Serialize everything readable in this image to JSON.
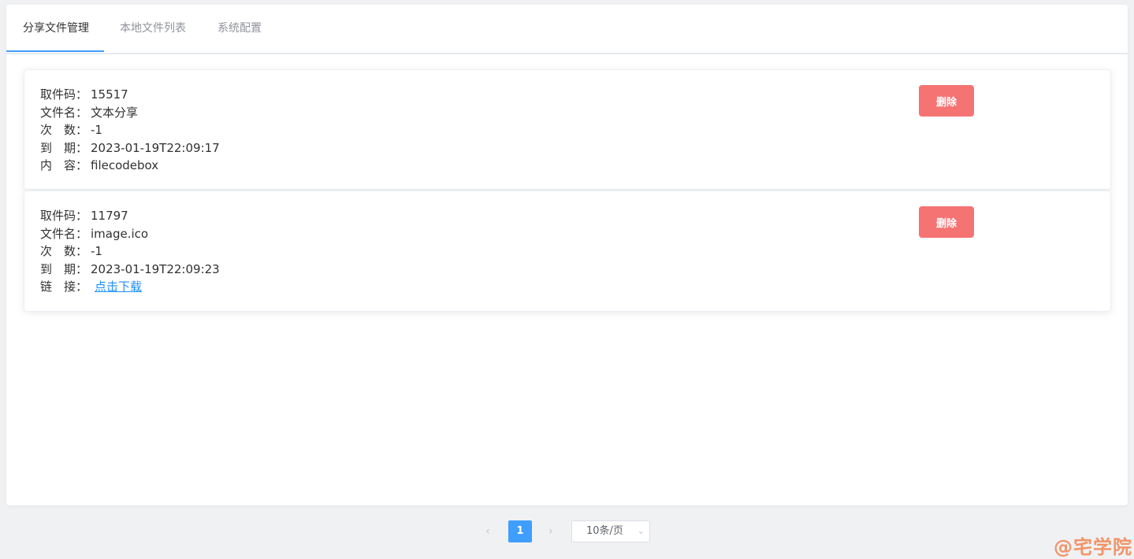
{
  "tabs": [
    {
      "label": "分享文件管理",
      "active": true
    },
    {
      "label": "本地文件列表",
      "active": false
    },
    {
      "label": "系统配置",
      "active": false
    }
  ],
  "cards": [
    {
      "fields": [
        {
          "key": "取件码：",
          "value": "15517"
        },
        {
          "key": "文件名：",
          "value": "文本分享"
        },
        {
          "key": "次　数：",
          "value": "-1"
        },
        {
          "key": "到　期：",
          "value": "2023-01-19T22:09:17"
        },
        {
          "key": "内　容：",
          "value": "filecodebox"
        }
      ],
      "delete_label": "删除"
    },
    {
      "fields": [
        {
          "key": "取件码：",
          "value": "11797"
        },
        {
          "key": "文件名：",
          "value": "image.ico"
        },
        {
          "key": "次　数：",
          "value": "-1"
        },
        {
          "key": "到　期：",
          "value": "2023-01-19T22:09:23"
        },
        {
          "key": "链　接：",
          "value": "点击下载"
        }
      ],
      "delete_label": "删除"
    }
  ],
  "pagination": {
    "prev": "‹",
    "next": "›",
    "current_page": "1",
    "page_size": "10条/页",
    "chevron": "⌄"
  },
  "watermark": "@宅学院",
  "colors": {
    "accent": "#409eff",
    "danger": "#f56c6c",
    "link": "#1e90ff"
  },
  "icons": {
    "prev": "chevron-left-icon",
    "next": "chevron-right-icon",
    "select": "chevron-down-icon"
  }
}
